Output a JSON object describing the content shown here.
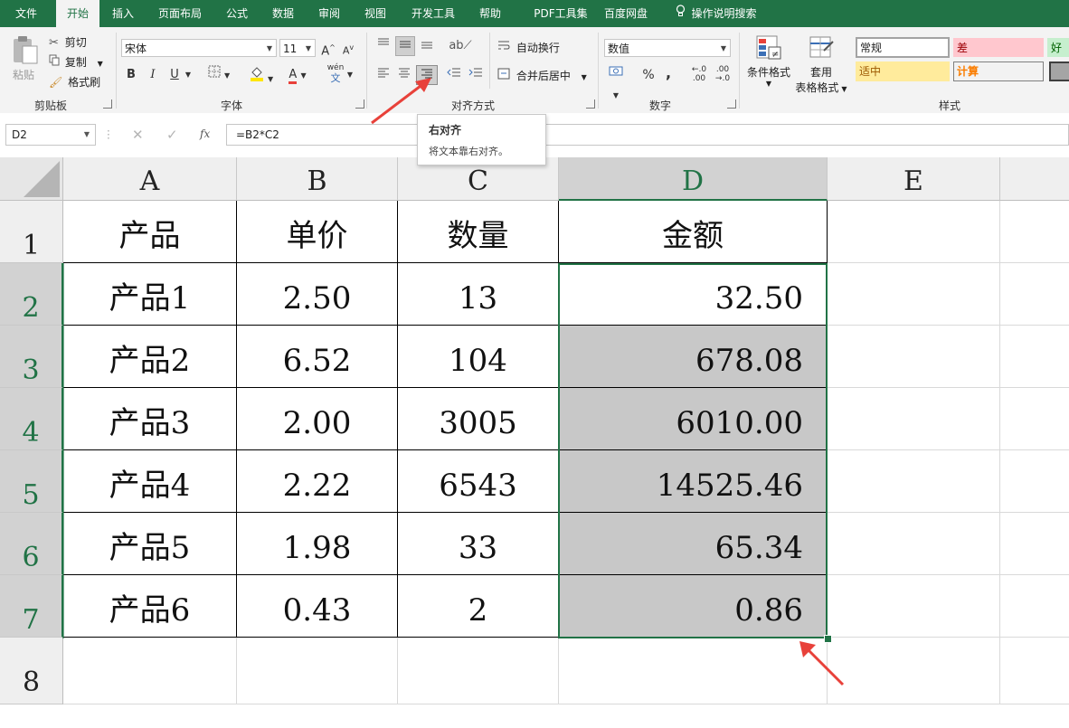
{
  "tabs": [
    {
      "label": "文件"
    },
    {
      "label": "开始"
    },
    {
      "label": "插入"
    },
    {
      "label": "页面布局"
    },
    {
      "label": "公式"
    },
    {
      "label": "数据"
    },
    {
      "label": "审阅"
    },
    {
      "label": "视图"
    },
    {
      "label": "开发工具"
    },
    {
      "label": "帮助"
    },
    {
      "label": "PDF工具集"
    },
    {
      "label": "百度网盘"
    },
    {
      "label": "操作说明搜索"
    }
  ],
  "active_tab": "开始",
  "clipboard": {
    "paste": "粘贴",
    "cut": "剪切",
    "copy": "复制",
    "format_painter": "格式刷",
    "group": "剪贴板"
  },
  "font": {
    "name": "宋体",
    "size": "11",
    "bold": "B",
    "italic": "I",
    "underline": "U",
    "grow": "A",
    "shrink": "A",
    "phonetic": "wén",
    "font_color_glyph": "A",
    "group": "字体"
  },
  "alignment": {
    "wrap": "自动换行",
    "merge": "合并后居中",
    "group": "对齐方式"
  },
  "number": {
    "format": "数值",
    "percent": "%",
    "comma": ",",
    "group": "数字"
  },
  "styles": {
    "conditional": "条件格式",
    "table_format_1": "套用",
    "table_format_2": "表格格式",
    "normal": "常规",
    "bad": "差",
    "good": "好",
    "neutral": "适中",
    "calculation": "计算",
    "group": "样式"
  },
  "tooltip": {
    "title": "右对齐",
    "desc": "将文本靠右对齐。"
  },
  "formula_bar": {
    "name_box": "D2",
    "fx": "fx",
    "formula": "=B2*C2"
  },
  "columns": [
    "A",
    "B",
    "C",
    "D",
    "E"
  ],
  "rows": [
    "1",
    "2",
    "3",
    "4",
    "5",
    "6",
    "7",
    "8"
  ],
  "sheet": {
    "header": [
      "产品",
      "单价",
      "数量",
      "金额"
    ],
    "data": [
      [
        "产品1",
        "2.50",
        "13",
        "32.50"
      ],
      [
        "产品2",
        "6.52",
        "104",
        "678.08"
      ],
      [
        "产品3",
        "2.00",
        "3005",
        "6010.00"
      ],
      [
        "产品4",
        "2.22",
        "6543",
        "14525.46"
      ],
      [
        "产品5",
        "1.98",
        "33",
        "65.34"
      ],
      [
        "产品6",
        "0.43",
        "2",
        "0.86"
      ]
    ]
  },
  "colors": {
    "accent": "#217346",
    "selected_fill": "#c8c8c8",
    "arrow": "#e8413a",
    "bad_fill": "#ffc7ce",
    "good_fill": "#c6efce",
    "neutral_fill": "#ffeb9c"
  }
}
